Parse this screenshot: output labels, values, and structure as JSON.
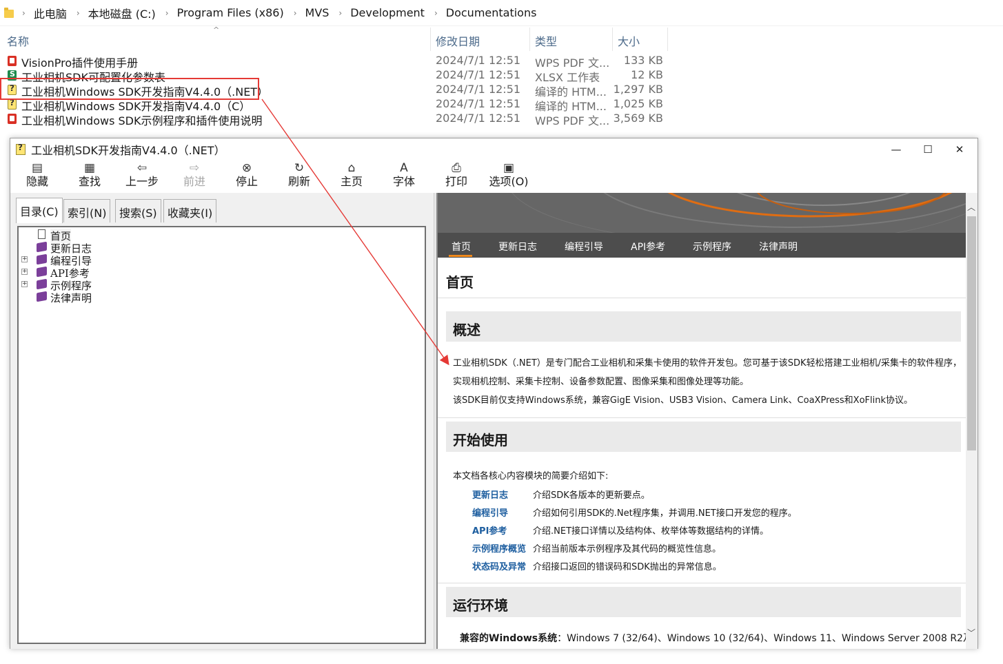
{
  "explorer": {
    "breadcrumb": [
      "此电脑",
      "本地磁盘 (C:)",
      "Program Files (x86)",
      "MVS",
      "Development",
      "Documentations"
    ],
    "columns": {
      "name": "名称",
      "date": "修改日期",
      "type": "类型",
      "size": "大小"
    },
    "files": [
      {
        "name": "VisionPro插件使用手册",
        "date": "2024/7/1 12:51",
        "type": "WPS PDF 文...",
        "size": "133 KB",
        "icon": "pdf-icon"
      },
      {
        "name": "工业相机SDK可配置化参数表",
        "date": "2024/7/1 12:51",
        "type": "XLSX 工作表",
        "size": "12 KB",
        "icon": "xlsx-icon"
      },
      {
        "name": "工业相机Windows SDK开发指南V4.4.0（.NET）",
        "date": "2024/7/1 12:51",
        "type": "编译的 HTM...",
        "size": "1,297 KB",
        "icon": "chm-icon"
      },
      {
        "name": "工业相机Windows SDK开发指南V4.4.0（C）",
        "date": "2024/7/1 12:51",
        "type": "编译的 HTM...",
        "size": "1,025 KB",
        "icon": "chm-icon"
      },
      {
        "name": "工业相机Windows SDK示例程序和插件使用说明",
        "date": "2024/7/1 12:51",
        "type": "WPS PDF 文...",
        "size": "3,569 KB",
        "icon": "pdf-icon"
      }
    ],
    "highlight_color": "#e53935"
  },
  "helpwin": {
    "title": "工业相机SDK开发指南V4.4.0（.NET）",
    "toolbar": [
      {
        "label": "隐藏",
        "icon": "hide-icon",
        "enabled": true
      },
      {
        "label": "查找",
        "icon": "find-icon",
        "enabled": true
      },
      {
        "label": "上一步",
        "icon": "back-icon",
        "enabled": true
      },
      {
        "label": "前进",
        "icon": "forward-icon",
        "enabled": false
      },
      {
        "label": "停止",
        "icon": "stop-icon",
        "enabled": true
      },
      {
        "label": "刷新",
        "icon": "refresh-icon",
        "enabled": true
      },
      {
        "label": "主页",
        "icon": "home-icon",
        "enabled": true
      },
      {
        "label": "字体",
        "icon": "font-icon",
        "enabled": true
      },
      {
        "label": "打印",
        "icon": "print-icon",
        "enabled": true
      },
      {
        "label": "选项(O)",
        "icon": "options-icon",
        "enabled": true
      }
    ],
    "tabs": [
      "目录(C)",
      "索引(N)",
      "搜索(S)",
      "收藏夹(I)"
    ],
    "tree": [
      {
        "label": "首页",
        "icon": "page-icon",
        "expandable": false
      },
      {
        "label": "更新日志",
        "icon": "book-icon",
        "expandable": false
      },
      {
        "label": "编程引导",
        "icon": "book-icon",
        "expandable": true
      },
      {
        "label": "API参考",
        "icon": "book-icon",
        "expandable": true
      },
      {
        "label": "示例程序",
        "icon": "book-icon",
        "expandable": true
      },
      {
        "label": "法律声明",
        "icon": "book-icon",
        "expandable": false
      }
    ],
    "content": {
      "nav": [
        "首页",
        "更新日志",
        "编程引导",
        "API参考",
        "示例程序",
        "法律声明"
      ],
      "page_title": "首页",
      "overview_heading": "概述",
      "overview_p1": "工业相机SDK（.NET）是专门配合工业相机和采集卡使用的软件开发包。您可基于该SDK轻松搭建工业相机/采集卡的软件程序，实现相机控制、采集卡控制、设备参数配置、图像采集和图像处理等功能。",
      "overview_p2": "该SDK目前仅支持Windows系统，兼容GigE Vision、USB3 Vision、Camera Link、CoaXPress和XoFlink协议。",
      "start_heading": "开始使用",
      "start_lead": "本文档各核心内容模块的简要介绍如下:",
      "modules": [
        {
          "name": "更新日志",
          "desc": "介绍SDK各版本的更新要点。"
        },
        {
          "name": "编程引导",
          "desc": "介绍如何引用SDK的.Net程序集，并调用.NET接口开发您的程序。"
        },
        {
          "name": "API参考",
          "desc": "介绍.NET接口详情以及结构体、枚举体等数据结构的详情。"
        },
        {
          "name": "示例程序概览",
          "desc": "介绍当前版本示例程序及其代码的概览性信息。"
        },
        {
          "name": "状态码及异常",
          "desc": "介绍接口返回的错误码和SDK抛出的异常信息。"
        }
      ],
      "env_heading": "运行环境",
      "env_label": "兼容的Windows系统",
      "env_value": "：Windows 7 (32/64)、Windows 10 (32/64)、Windows 11、Windows Server 2008 R2及"
    },
    "colors": {
      "banner": "#666666",
      "navbar": "#4d4d4d",
      "accent": "#f28a1b",
      "link": "#1f5fa0"
    }
  }
}
